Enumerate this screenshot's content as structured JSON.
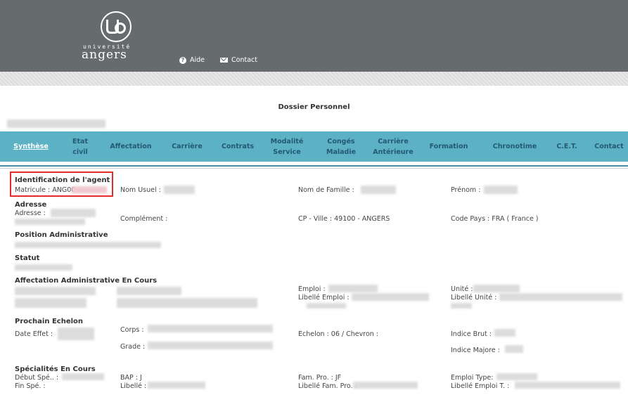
{
  "header": {
    "logo_small": "université",
    "logo_main": "angers",
    "aide": "Aide",
    "contact": "Contact"
  },
  "page_title": "Dossier Personnel",
  "tabs": [
    {
      "label": "Synthèse",
      "active": true
    },
    {
      "label": "Etat civil",
      "active": false
    },
    {
      "label": "Affectation",
      "active": false
    },
    {
      "label": "Carrière",
      "active": false
    },
    {
      "label": "Contrats",
      "active": false
    },
    {
      "label": "Modalité Service",
      "active": false
    },
    {
      "label": "Congés Maladie",
      "active": false
    },
    {
      "label": "Carrière Antérieure",
      "active": false
    },
    {
      "label": "Formation",
      "active": false
    },
    {
      "label": "Chronotime",
      "active": false
    },
    {
      "label": "C.E.T.",
      "active": false
    },
    {
      "label": "Contact",
      "active": false
    }
  ],
  "identification": {
    "title": "Identification de l'agent",
    "matricule": "Matricule : ANG00",
    "nom_usuel": "Nom Usuel :",
    "nom_famille": "Nom de Famille :",
    "prenom": "Prénom :"
  },
  "adresse": {
    "title": "Adresse",
    "adresse": "Adresse :",
    "complement": "Complément :",
    "cp_ville": "CP - Ville : 49100 - ANGERS",
    "code_pays": "Code Pays : FRA ( France )"
  },
  "position": {
    "title": "Position Administrative"
  },
  "statut": {
    "title": "Statut"
  },
  "affectation": {
    "title": "Affectation Administrative En Cours",
    "emploi": "Emploi :",
    "libelle_emploi": "Libellé Emploi :",
    "unite": "Unité :",
    "libelle_unite": "Libellé Unité :"
  },
  "echelon": {
    "title": "Prochain Echelon",
    "date_effet": "Date Effet :",
    "corps": "Corps :",
    "grade": "Grade :",
    "echelon": "Echelon : 06 / Chevron :",
    "indice_brut": "Indice Brut :",
    "indice_majore": "Indice Majore :"
  },
  "specialites": {
    "title": "Spécialités En Cours",
    "debut": "Début Spé.. :",
    "fin": "Fin Spé. :",
    "bap": "BAP : J",
    "libelle": "Libellé :",
    "fam_pro": "Fam. Pro. : JF",
    "libelle_fam_pro": "Libellé Fam. Pro. :",
    "emploi_type": "Emploi Type:",
    "libelle_emploi_t": "Libellé Emploi T. :"
  }
}
